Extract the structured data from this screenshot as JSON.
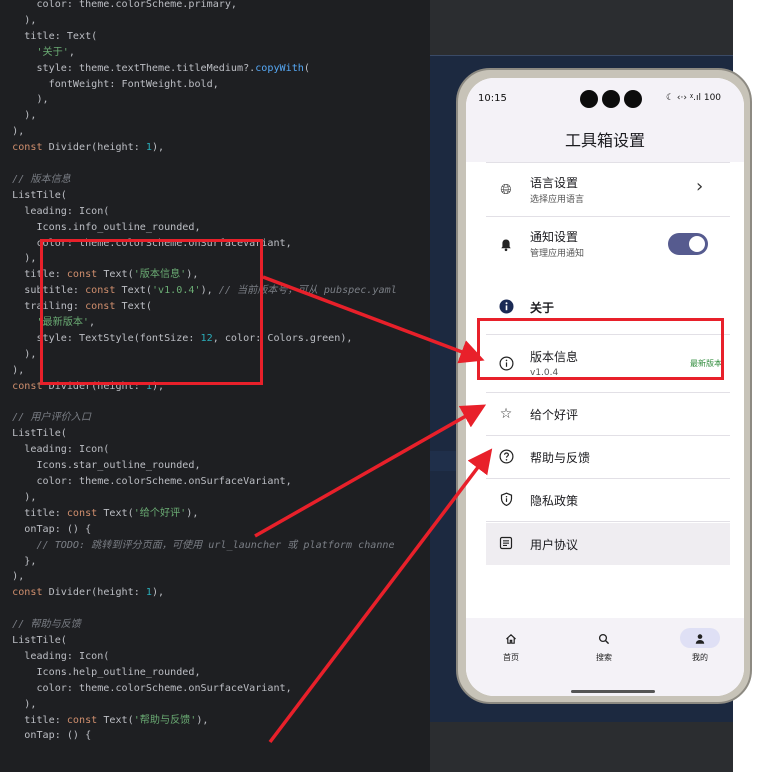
{
  "editor": {
    "lines": [
      [
        [
          "pl",
          "      color: theme.colorScheme.primary,"
        ]
      ],
      [
        [
          "pl",
          "    ),"
        ]
      ],
      [
        [
          "pl",
          "    title: Text("
        ]
      ],
      [
        [
          "st",
          "      '关于'"
        ],
        [
          "pl",
          ","
        ]
      ],
      [
        [
          "pl",
          "      style: theme.textTheme.titleMedium?."
        ],
        [
          "fn",
          "copyWith"
        ],
        [
          "pl",
          "("
        ]
      ],
      [
        [
          "pl",
          "        fontWeight: FontWeight.bold,"
        ]
      ],
      [
        [
          "pl",
          "      ),"
        ]
      ],
      [
        [
          "pl",
          "    ),"
        ]
      ],
      [
        [
          "pl",
          "  ),"
        ]
      ],
      [
        [
          "kw",
          "  const "
        ],
        [
          "pl",
          "Divider(height: "
        ],
        [
          "nm",
          "1"
        ],
        [
          "pl",
          "),"
        ]
      ],
      [
        [
          "pl",
          ""
        ]
      ],
      [
        [
          "cm",
          "  // 版本信息"
        ]
      ],
      [
        [
          "pl",
          "  ListTile("
        ]
      ],
      [
        [
          "pl",
          "    leading: Icon("
        ]
      ],
      [
        [
          "pl",
          "      Icons.info_outline_rounded,"
        ]
      ],
      [
        [
          "pl",
          "      color: theme.colorScheme.onSurfaceVariant,"
        ]
      ],
      [
        [
          "pl",
          "    ),"
        ]
      ],
      [
        [
          "pl",
          "    title: "
        ],
        [
          "kw",
          "const "
        ],
        [
          "pl",
          "Text("
        ],
        [
          "st",
          "'版本信息'"
        ],
        [
          "pl",
          "),"
        ]
      ],
      [
        [
          "pl",
          "    subtitle: "
        ],
        [
          "kw",
          "const "
        ],
        [
          "pl",
          "Text("
        ],
        [
          "st",
          "'v1.0.4'"
        ],
        [
          "pl",
          "), "
        ],
        [
          "cm",
          "// 当前版本号，可从 pubspec.yaml"
        ]
      ],
      [
        [
          "pl",
          "    trailing: "
        ],
        [
          "kw",
          "const "
        ],
        [
          "pl",
          "Text("
        ]
      ],
      [
        [
          "st",
          "      '最新版本'"
        ],
        [
          "pl",
          ","
        ]
      ],
      [
        [
          "pl",
          "      style: TextStyle(fontSize: "
        ],
        [
          "nm",
          "12"
        ],
        [
          "pl",
          ", color: Colors.green),"
        ]
      ],
      [
        [
          "pl",
          "    ),"
        ]
      ],
      [
        [
          "pl",
          "  ),"
        ]
      ],
      [
        [
          "kw",
          "  const "
        ],
        [
          "pl",
          "Divider(height: "
        ],
        [
          "nm",
          "1"
        ],
        [
          "pl",
          "),"
        ]
      ],
      [
        [
          "pl",
          ""
        ]
      ],
      [
        [
          "cm",
          "  // 用户评价入口"
        ]
      ],
      [
        [
          "pl",
          "  ListTile("
        ]
      ],
      [
        [
          "pl",
          "    leading: Icon("
        ]
      ],
      [
        [
          "pl",
          "      Icons.star_outline_rounded,"
        ]
      ],
      [
        [
          "pl",
          "      color: theme.colorScheme.onSurfaceVariant,"
        ]
      ],
      [
        [
          "pl",
          "    ),"
        ]
      ],
      [
        [
          "pl",
          "    title: "
        ],
        [
          "kw",
          "const "
        ],
        [
          "pl",
          "Text("
        ],
        [
          "st",
          "'给个好评'"
        ],
        [
          "pl",
          "),"
        ]
      ],
      [
        [
          "pl",
          "    onTap: () {"
        ]
      ],
      [
        [
          "cm",
          "      // TODO: 跳转到评分页面，可使用 url_launcher 或 platform channe"
        ]
      ],
      [
        [
          "pl",
          "    },"
        ]
      ],
      [
        [
          "pl",
          "  ),"
        ]
      ],
      [
        [
          "kw",
          "  const "
        ],
        [
          "pl",
          "Divider(height: "
        ],
        [
          "nm",
          "1"
        ],
        [
          "pl",
          "),"
        ]
      ],
      [
        [
          "pl",
          ""
        ]
      ],
      [
        [
          "cm",
          "  // 帮助与反馈"
        ]
      ],
      [
        [
          "pl",
          "  ListTile("
        ]
      ],
      [
        [
          "pl",
          "    leading: Icon("
        ]
      ],
      [
        [
          "pl",
          "      Icons.help_outline_rounded,"
        ]
      ],
      [
        [
          "pl",
          "      color: theme.colorScheme.onSurfaceVariant,"
        ]
      ],
      [
        [
          "pl",
          "    ),"
        ]
      ],
      [
        [
          "pl",
          "    title: "
        ],
        [
          "kw",
          "const "
        ],
        [
          "pl",
          "Text("
        ],
        [
          "st",
          "'帮助与反馈'"
        ],
        [
          "pl",
          "),"
        ]
      ],
      [
        [
          "pl",
          "    onTap: () {"
        ]
      ]
    ]
  },
  "phone": {
    "status": {
      "time": "10:15",
      "right": "☾ ‹·› ᵡ.ıl 100"
    },
    "app_title": "工具箱设置",
    "language": {
      "title": "语言设置",
      "subtitle": "选择应用语言",
      "trailing": "›"
    },
    "notify": {
      "title": "通知设置",
      "subtitle": "管理应用通知",
      "enabled": true
    },
    "about_header": "关于",
    "version": {
      "title": "版本信息",
      "subtitle": "v1.0.4",
      "badge": "最新版本"
    },
    "rate": {
      "title": "给个好评"
    },
    "help": {
      "title": "帮助与反馈"
    },
    "privacy": {
      "title": "隐私政策"
    },
    "terms": {
      "title": "用户协议"
    },
    "nav": [
      {
        "label": "首页",
        "icon": "home-icon",
        "active": false
      },
      {
        "label": "搜索",
        "icon": "search-icon",
        "active": false
      },
      {
        "label": "我的",
        "icon": "person-icon",
        "active": true
      }
    ]
  },
  "colors": {
    "highlight": "#e8202a",
    "toggle": "#565b8f",
    "badge": "#2e8b3a"
  }
}
